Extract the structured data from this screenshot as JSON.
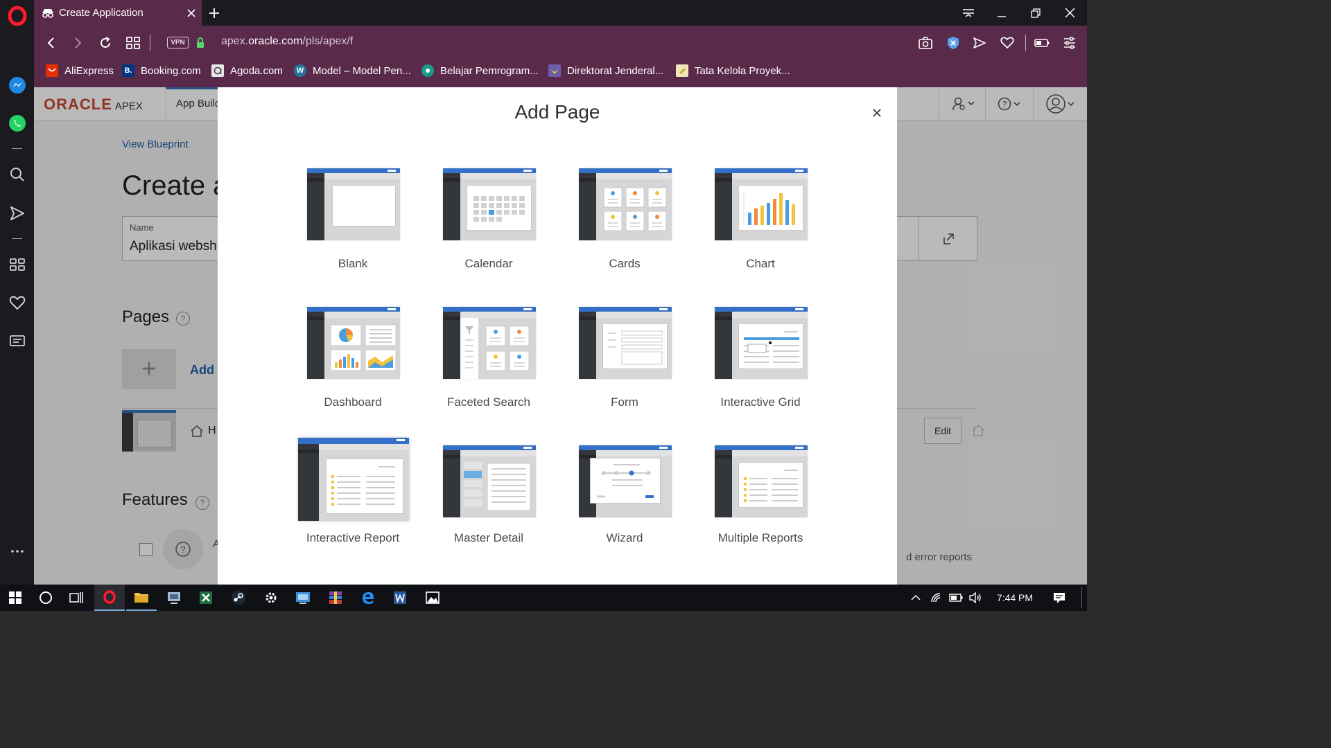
{
  "browser": {
    "tab_title": "Create Application",
    "vpn_label": "VPN",
    "url_prefix": "apex.",
    "url_domain": "oracle.com",
    "url_path": "/pls/apex/f",
    "bookmarks": [
      {
        "label": "AliExpress",
        "icon": "aliexpress-icon",
        "color": "#e62e04"
      },
      {
        "label": "Booking.com",
        "icon": "booking-icon",
        "color": "#003580"
      },
      {
        "label": "Agoda.com",
        "icon": "agoda-icon",
        "color": "#cfcfcf"
      },
      {
        "label": "Model – Model Pen...",
        "icon": "wordpress-icon",
        "color": "#21759b"
      },
      {
        "label": "Belajar Pemrogram...",
        "icon": "site-icon",
        "color": "#1a9a8a"
      },
      {
        "label": "Direktorat Jenderal...",
        "icon": "garuda-icon",
        "color": "#6b5da8"
      },
      {
        "label": "Tata Kelola Proyek...",
        "icon": "note-icon",
        "color": "#e9d46a"
      }
    ]
  },
  "apex": {
    "logo": "ORACLE",
    "logo_sub": "APEX",
    "app_builder_tab": "App Build",
    "view_blueprint": "View Blueprint",
    "page_title": "Create a",
    "name_label": "Name",
    "name_value": "Aplikasi websh",
    "pages_heading": "Pages",
    "add_label": "Add",
    "home_label": "H",
    "edit_label": "Edit",
    "features_heading": "Features",
    "feature_row_label": "A",
    "error_reports_text": "d error reports"
  },
  "modal": {
    "title": "Add Page",
    "close_label": "×",
    "page_types": [
      {
        "label": "Blank",
        "icon": "blank-page-icon"
      },
      {
        "label": "Calendar",
        "icon": "calendar-page-icon"
      },
      {
        "label": "Cards",
        "icon": "cards-page-icon"
      },
      {
        "label": "Chart",
        "icon": "chart-page-icon"
      },
      {
        "label": "Dashboard",
        "icon": "dashboard-page-icon"
      },
      {
        "label": "Faceted Search",
        "icon": "faceted-search-page-icon"
      },
      {
        "label": "Form",
        "icon": "form-page-icon"
      },
      {
        "label": "Interactive Grid",
        "icon": "interactive-grid-page-icon"
      },
      {
        "label": "Interactive Report",
        "icon": "interactive-report-page-icon"
      },
      {
        "label": "Master Detail",
        "icon": "master-detail-page-icon"
      },
      {
        "label": "Wizard",
        "icon": "wizard-page-icon"
      },
      {
        "label": "Multiple Reports",
        "icon": "multiple-reports-page-icon"
      }
    ]
  },
  "taskbar": {
    "clock": "7:44 PM"
  },
  "colors": {
    "browser_accent": "#5a2a4a",
    "apex_blue": "#3470c8",
    "oracle_red": "#c74634"
  }
}
